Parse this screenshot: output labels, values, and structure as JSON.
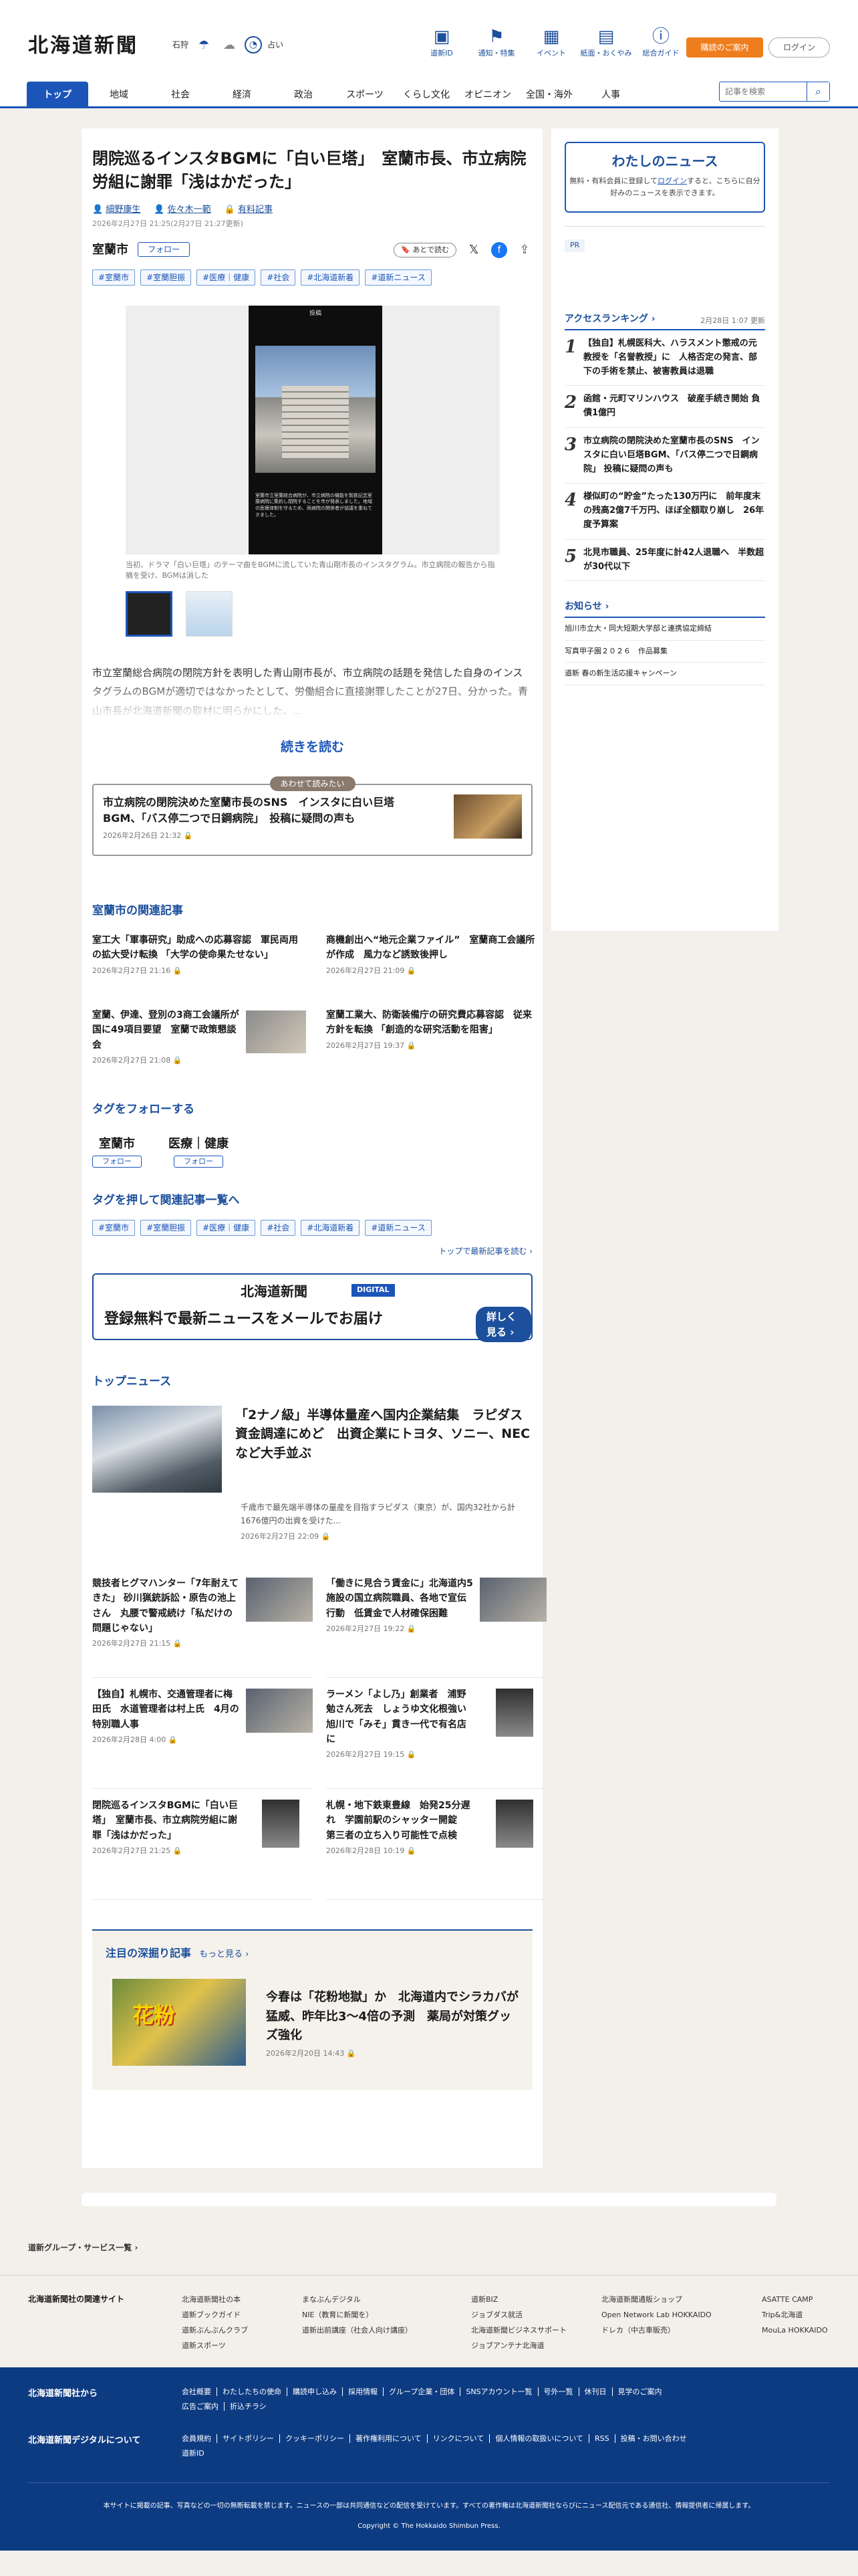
{
  "header": {
    "logo": "北海道新聞",
    "weather_city": "石狩",
    "weather_label": "占い",
    "icons": [
      {
        "label": "道新ID",
        "icon": "id-card-icon"
      },
      {
        "label": "通知・特集",
        "icon": "flag-icon"
      },
      {
        "label": "イベント",
        "icon": "calendar-icon"
      },
      {
        "label": "紙面・おくやみ",
        "icon": "newspaper-icon"
      },
      {
        "label": "総合ガイド",
        "icon": "question-icon"
      }
    ],
    "subscribe": "購読のご案内",
    "login": "ログイン"
  },
  "nav": {
    "items": [
      "トップ",
      "地域",
      "社会",
      "経済",
      "政治",
      "スポーツ",
      "くらし文化",
      "オピニオン",
      "全国・海外",
      "人事"
    ],
    "search_placeholder": "記事を検索"
  },
  "article": {
    "title": "閉院巡るインスタBGMに「白い巨塔」　室蘭市長、市立病院労組に謝罪「浅はかだった」",
    "authors": [
      "細野康生",
      "佐々木一範"
    ],
    "paywall": "有料記事",
    "date": "2026年2月27日 21:25(2月27日 21:27更新)",
    "save_later": "あとで読む",
    "area": "室蘭市",
    "follow": "フォロー",
    "tags": [
      "#室蘭市",
      "#室蘭胆振",
      "#医療｜健康",
      "#社会",
      "#北海道新着",
      "#道新ニュース"
    ],
    "phone_header": "投稿",
    "phone_text": "室蘭市立室蘭総合病院が、市立病院の機能を製鉄記念室蘭病院に集約し閉院することを市が発表しました。地域の医療体制を守るため、両病院の関係者が協議を重ねてきました。",
    "caption": "当初、ドラマ「白い巨塔」のテーマ曲をBGMに流していた青山剛市長のインスタグラム。市立病院の報告から指摘を受け、BGMは消した",
    "lead": "市立室蘭総合病院の閉院方針を表明した青山剛市長が、市立病院の話題を発信した自身のインスタグラムのBGMが適切ではなかったとして、労働組合に直接謝罪したことが27日、分かった。青山市長が北海道新聞の取材に明らかにした。...",
    "read_more": "続きを読む"
  },
  "related_box": {
    "label": "あわせて読みたい",
    "title": "市立病院の閉院決めた室蘭市長のSNS　インスタに白い巨塔BGM、「バス停二つで日鋼病院」　投稿に疑問の声も",
    "date": "2026年2月26日 21:32"
  },
  "area_news": {
    "heading": "室蘭市の関連記事",
    "items": [
      {
        "title": "室工大「軍事研究」助成への応募容認　軍民両用の拡大受け転換 「大学の使命果たせない」",
        "date": "2026年2月27日 21:16"
      },
      {
        "title": "商機創出へ“地元企業ファイル”　室蘭商工会議所が作成　風力など誘致後押し",
        "date": "2026年2月27日 21:09"
      },
      {
        "title": "室蘭、伊達、登別の3商工会議所が国に49項目要望　室蘭で政策懇談会",
        "date": "2026年2月27日 21:08"
      },
      {
        "title": "室蘭工業大、防衛装備庁の研究費応募容認　従来方針を転換 「創造的な研究活動を阻害」",
        "date": "2026年2月27日 19:37"
      }
    ]
  },
  "follow_tags": {
    "heading": "タグをフォローする",
    "items": [
      {
        "name": "室蘭市",
        "btn": "フォロー"
      },
      {
        "name": "医療｜健康",
        "btn": "フォロー"
      }
    ]
  },
  "tag_list": {
    "heading": "タグを押して関連記事一覧へ",
    "more": "トップで最新記事を読む"
  },
  "banner": {
    "logo": "北海道新聞",
    "badge": "DIGITAL",
    "text": "登録無料で最新ニュースをメールでお届け",
    "button": "詳しく見る"
  },
  "top_news": {
    "heading": "トップニュース",
    "main": {
      "title": "「2ナノ級」半導体量産へ国内企業結集　ラピダス資金調達にめど　出資企業にトヨタ、ソニー、NECなど大手並ぶ",
      "summary": "千歳市で最先端半導体の量産を目指すラピダス（東京）が、国内32社から計1676億円の出資を受けた...",
      "date": "2026年2月27日 22:09"
    },
    "items": [
      {
        "title": "競技者ヒグマハンター「7年耐えてきた」 砂川猟銃訴訟・原告の池上さん　丸腰で警戒続け「私だけの問題じゃない」",
        "date": "2026年2月27日 21:15"
      },
      {
        "title": "「働きに見合う賃金に」北海道内5施設の国立病院職員、各地で宣伝行動　低賃金で人材確保困難",
        "date": "2026年2月27日 19:22"
      },
      {
        "title": "【独自】札幌市、交通管理者に梅田氏　水道管理者は村上氏　4月の特別職人事",
        "date": "2026年2月28日 4:00"
      },
      {
        "title": "ラーメン「よし乃」創業者　浦野勉さん死去　しょうゆ文化根強い旭川で「みそ」貫き一代で有名店に",
        "date": "2026年2月27日 19:15"
      },
      {
        "title": "閉院巡るインスタBGMに「白い巨塔」　室蘭市長、市立病院労組に謝罪「浅はかだった」",
        "date": "2026年2月27日 21:25"
      },
      {
        "title": "札幌・地下鉄東豊線　始発25分遅れ　学園前駅のシャッター開錠　第三者の立ち入り可能性で点検",
        "date": "2026年2月28日 10:19"
      }
    ]
  },
  "feature": {
    "heading": "注目の深掘り記事",
    "more": "もっと見る",
    "img_text": "花粉",
    "title": "今春は「花粉地獄」か　北海道内でシラカバが猛威、昨年比3〜4倍の予測　薬局が対策グッズ強化",
    "date": "2026年2月20日 14:43"
  },
  "sidebar": {
    "mynews_title": "わたしのニュース",
    "mynews_text1": "無料・有料会員に登録して",
    "mynews_login": "ログイン",
    "mynews_text2": "すると、こちらに自分好みのニュースを表示できます。",
    "pr": "PR",
    "ranking_title": "アクセスランキング",
    "ranking_updated": "2月28日 1:07 更新",
    "ranking": [
      "【独自】札幌医科大、ハラスメント懲戒の元教授を「名誉教授」に　人格否定の発言、部下の手術を禁止、被害教員は退職",
      "函館・元町マリンハウス　破産手続き開始 負債1億円",
      "市立病院の閉院決めた室蘭市長のSNS　インスタに白い巨塔BGM、「バス停二つで日鋼病院」 投稿に疑問の声も",
      "様似町の“貯金”たった130万円に　前年度末の残高2億7千万円、ほぼ全額取り崩し　26年度予算案",
      "北見市職員、25年度に計42人退職へ　半数超が30代以下"
    ],
    "notice_title": "お知らせ",
    "notices": [
      "旭川市立大・同大短期大学部と連携協定締結",
      "写真甲子園２０２６　作品募集",
      "道新 春の新生活応援キャンペーン"
    ]
  },
  "footer": {
    "group": "道新グループ・サービス一覧",
    "sites_label": "北海道新聞社の関連サイト",
    "cols": [
      [
        "北海道新聞社の本",
        "道新ブックガイド",
        "道新ぶんぶんクラブ",
        "道新スポーツ"
      ],
      [
        "まなぶんデジタル",
        "NIE（教育に新聞を）",
        "道新出前講座（社会人向け講座）"
      ],
      [
        "道新BIZ",
        "ジョブダス就活",
        "北海道新聞ビジネスサポート",
        "ジョブアンテナ北海道"
      ],
      [
        "北海道新聞通販ショップ",
        "Open Network Lab HOKKAIDO",
        "ドレカ（中古車販売）"
      ],
      [
        "ASATTE CAMP",
        "Trip&北海道",
        "MouLa HOKKAIDO"
      ]
    ],
    "about_label": "北海道新聞社から",
    "about_links": [
      "会社概要",
      "わたしたちの使命",
      "購読申し込み",
      "採用情報",
      "グループ企業・団体",
      "SNSアカウント一覧",
      "号外一覧",
      "休刊日",
      "見学のご案内",
      "広告ご案内",
      "折込チラシ"
    ],
    "digital_label": "北海道新聞デジタルについて",
    "digital_links": [
      "会員規約",
      "サイトポリシー",
      "クッキーポリシー",
      "著作権利用について",
      "リンクについて",
      "個人情報の取扱いについて",
      "RSS",
      "投稿・お問い合わせ",
      "道新ID"
    ],
    "note": "本サイトに掲載の記事、写真などの一切の無断転載を禁じます。ニュースの一部は共同通信などの配信を受けています。すべての著作権は北海道新聞社ならびにニュース配信元である通信社、情報提供者に帰属します。",
    "copyright": "Copyright © The Hokkaido Shimbun Press."
  }
}
